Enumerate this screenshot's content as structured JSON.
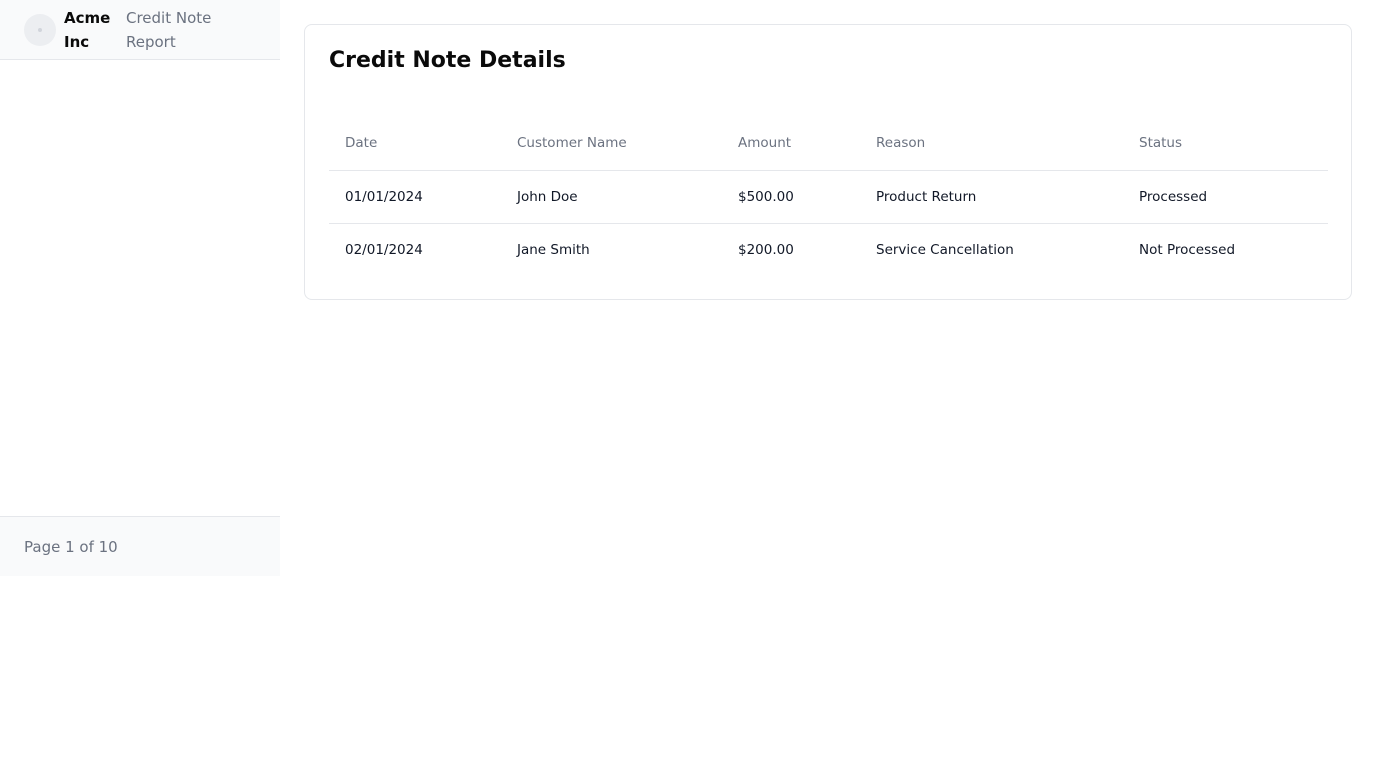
{
  "sidebar": {
    "company_name": "Acme Inc",
    "report_name": "Credit Note Report",
    "avatar_icon": "avatar-placeholder-icon",
    "page_indicator": "Page 1 of 10"
  },
  "card": {
    "title": "Credit Note Details"
  },
  "table": {
    "headers": [
      "Date",
      "Customer Name",
      "Amount",
      "Reason",
      "Status"
    ],
    "rows": [
      {
        "date": "01/01/2024",
        "customer": "John Doe",
        "amount": "$500.00",
        "reason": "Product Return",
        "status": "Processed"
      },
      {
        "date": "02/01/2024",
        "customer": "Jane Smith",
        "amount": "$200.00",
        "reason": "Service Cancellation",
        "status": "Not Processed"
      }
    ]
  }
}
